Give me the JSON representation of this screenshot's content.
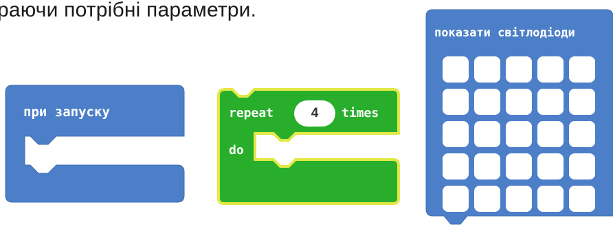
{
  "caption": "раючи потрібні параметри.",
  "start_block": {
    "label": "при запуску",
    "color": "#4C7FC8"
  },
  "repeat_block": {
    "repeat_label": "repeat",
    "count": "4",
    "times_label": "times",
    "do_label": "do",
    "color": "#29AE2C",
    "outline_color": "#E2E846"
  },
  "show_leds_block": {
    "label": "показати світлодіоди",
    "color": "#4C7FC8",
    "rows": 5,
    "columns": 5,
    "led_state": "all off"
  }
}
